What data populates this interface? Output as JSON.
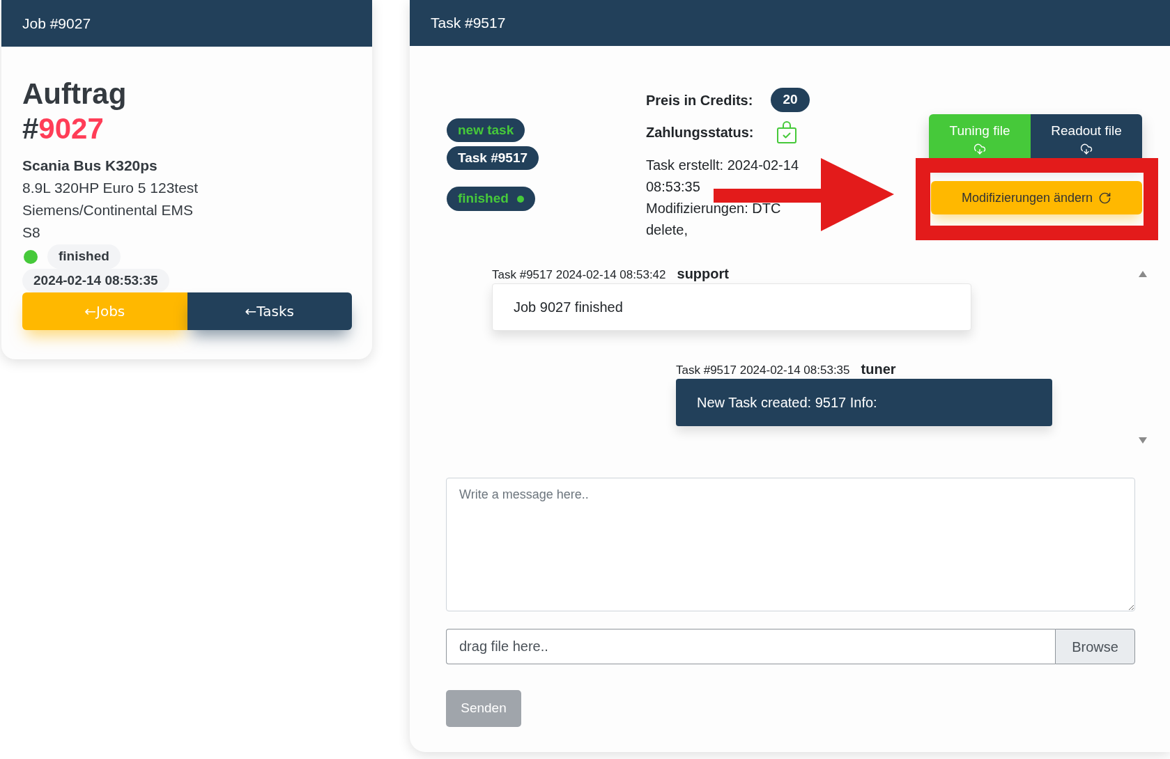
{
  "job_panel": {
    "title": "Job #9027",
    "heading": {
      "title": "Auftrag",
      "prefix": "#",
      "number": "9027"
    },
    "vehicle": "Scania Bus K320ps",
    "details": [
      "8.9L 320HP Euro 5 123test",
      "Siemens/Continental EMS S8"
    ],
    "status": {
      "label": "finished",
      "color": "#46c93a"
    },
    "date": "2024-02-14 08:53:35",
    "buttons": [
      {
        "label": "←Jobs",
        "kind": "primary"
      },
      {
        "label": "←Tasks",
        "kind": "secondary"
      }
    ]
  },
  "task_panel": {
    "title": "Task #9517",
    "tags": [
      {
        "text": "new task",
        "kind": "state"
      },
      {
        "text": "Task #9517",
        "kind": "id"
      }
    ],
    "status": {
      "label": "finished",
      "color": "#46c93a"
    },
    "price_label": "Preis in Credits:",
    "price": "20",
    "payment_label": "Zahlungsstatus:",
    "paid": true,
    "created": "Task erstellt: 2024-02-14 08:53:35",
    "modifications": "Modifizierungen: DTC delete,",
    "files": [
      {
        "label": "Tuning file",
        "color": "#46c93a"
      },
      {
        "label": "Readout file",
        "color": "#22405a"
      }
    ],
    "modify_button": "Modifizierungen ändern",
    "annotations": {
      "arrow": true,
      "frame": true
    }
  },
  "chat": {
    "messages": [
      {
        "meta": "Task #9517 2024-02-14 08:53:42",
        "author": "support",
        "text": "Job 9027 finished",
        "kind": "incoming"
      },
      {
        "meta": "Task #9517 2024-02-14 08:53:35",
        "author": "tuner",
        "text": "New Task created: 9517 Info:",
        "kind": "outgoing"
      }
    ]
  },
  "composer": {
    "placeholder": "Write a message here..",
    "file_placeholder": "drag file here..",
    "browse": "Browse",
    "send": {
      "label": "Senden",
      "disabled": true
    }
  }
}
